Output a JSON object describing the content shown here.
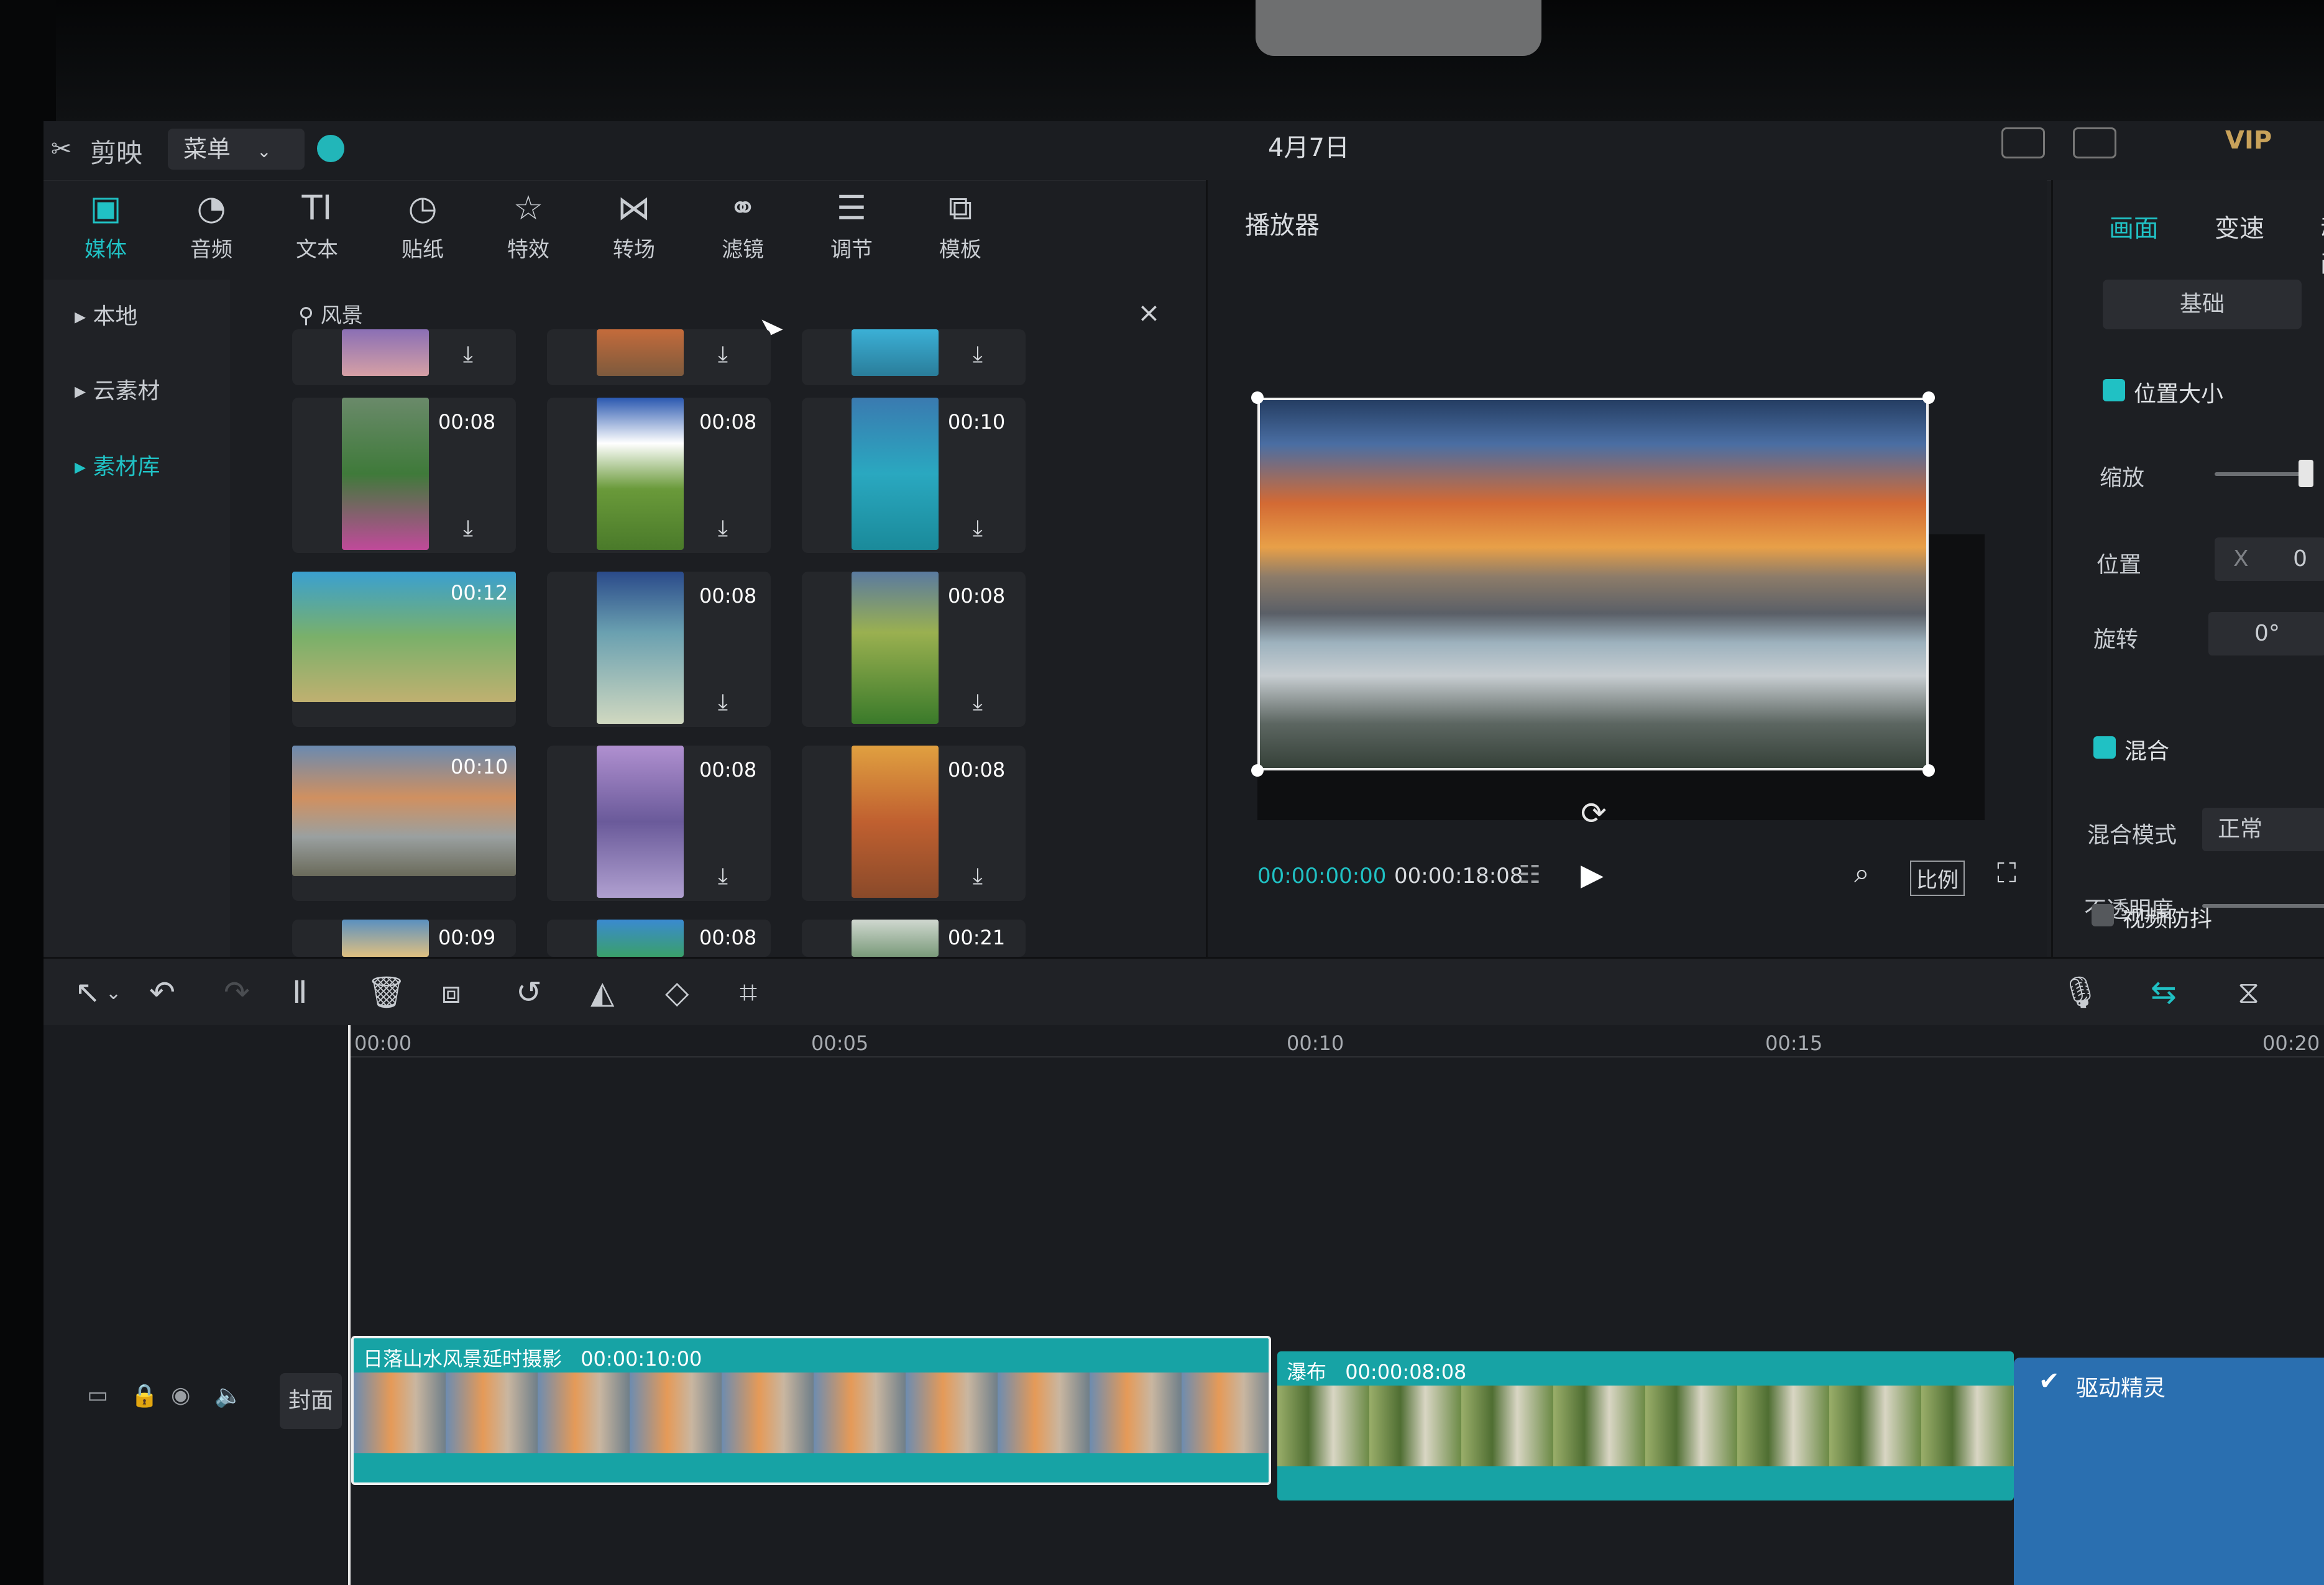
{
  "app": {
    "logo": "剪映",
    "menu_label": "菜单",
    "project_title": "4月7日",
    "vip_label": "VIP"
  },
  "media_tabs": [
    {
      "label": "媒体",
      "icon": "media-icon",
      "active": true
    },
    {
      "label": "音频",
      "icon": "audio-icon"
    },
    {
      "label": "文本",
      "icon": "text-icon"
    },
    {
      "label": "贴纸",
      "icon": "sticker-icon"
    },
    {
      "label": "特效",
      "icon": "effects-icon"
    },
    {
      "label": "转场",
      "icon": "transition-icon"
    },
    {
      "label": "滤镜",
      "icon": "filter-icon"
    },
    {
      "label": "调节",
      "icon": "adjust-icon"
    },
    {
      "label": "模板",
      "icon": "template-icon"
    }
  ],
  "categories": [
    {
      "label": "本地"
    },
    {
      "label": "云素材"
    },
    {
      "label": "素材库",
      "active": true
    }
  ],
  "search": {
    "query": "风景",
    "close": "×"
  },
  "media_items": [
    {
      "duration": ""
    },
    {
      "duration": ""
    },
    {
      "duration": ""
    },
    {
      "duration": "00:08"
    },
    {
      "duration": "00:08"
    },
    {
      "duration": "00:10"
    },
    {
      "duration": "00:12"
    },
    {
      "duration": "00:08"
    },
    {
      "duration": "00:08"
    },
    {
      "duration": "00:10"
    },
    {
      "duration": "00:08"
    },
    {
      "duration": "00:08"
    },
    {
      "duration": "00:09"
    },
    {
      "duration": "00:08"
    },
    {
      "duration": "00:21"
    }
  ],
  "player": {
    "title": "播放器",
    "current_time": "00:00:00:00",
    "total_time": "00:00:18:08",
    "ratio_label": "比例"
  },
  "inspector": {
    "tabs": [
      "画面",
      "变速",
      "动画"
    ],
    "basic_label": "基础",
    "position_size_label": "位置大小",
    "scale_label": "缩放",
    "position_label": "位置",
    "position_x_label": "X",
    "position_x_value": "0",
    "rotation_label": "旋转",
    "rotation_value": "0°",
    "blend_label": "混合",
    "blend_mode_label": "混合模式",
    "blend_mode_value": "正常",
    "opacity_label": "不透明度",
    "stabilize_label": "视频防抖"
  },
  "timeline": {
    "ruler": [
      "00:00",
      "00:05",
      "00:10",
      "00:15",
      "00:20"
    ],
    "cover_label": "封面",
    "clips": [
      {
        "name": "日落山水风景延时摄影",
        "duration": "00:00:10:00"
      },
      {
        "name": "瀑布",
        "duration": "00:00:08:08"
      }
    ],
    "assistant_label": "驱动精灵"
  },
  "colors": {
    "accent": "#20c1c4",
    "clip": "#17a3a5",
    "background": "#1c1e22"
  }
}
